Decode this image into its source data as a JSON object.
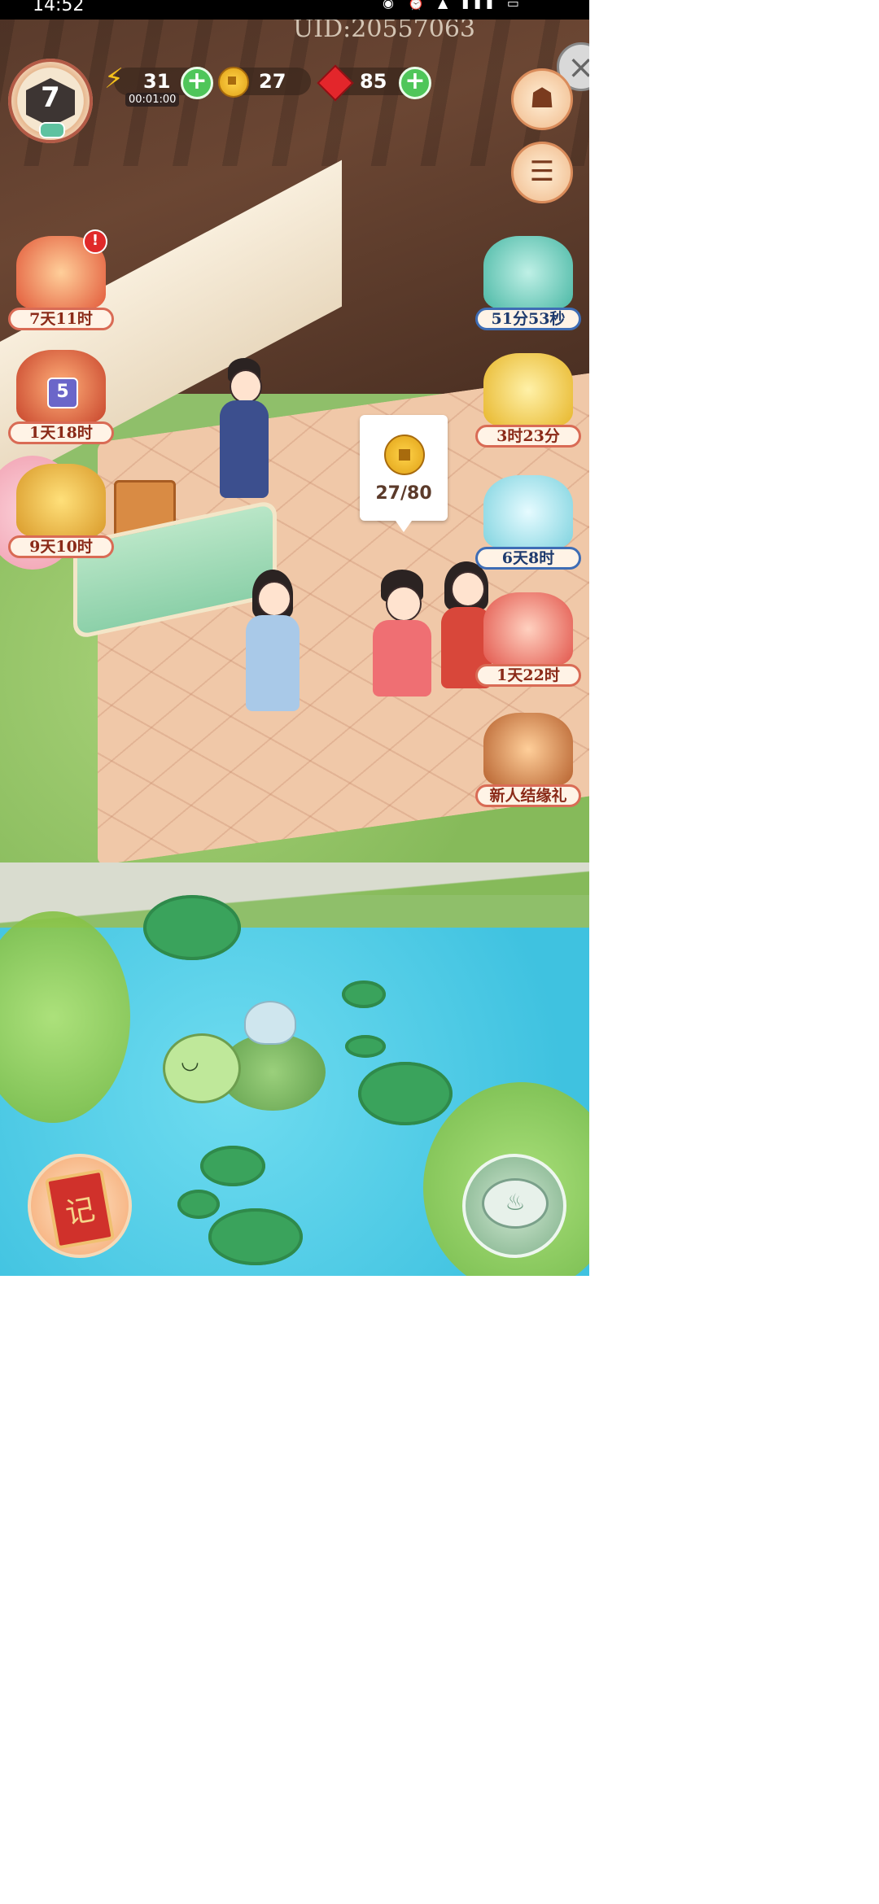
{
  "status_bar": {
    "time": "14:52",
    "icons": "◉ ⏰ ▲ ▮▮▮ ▭"
  },
  "header": {
    "uid": "UID:20557063"
  },
  "player": {
    "level": "7"
  },
  "resources": {
    "energy": {
      "value": "31",
      "timer": "00:01:00",
      "icon": "lightning-icon"
    },
    "coins": {
      "value": "27",
      "icon": "coin-icon"
    },
    "gems": {
      "value": "85",
      "icon": "ruby-icon"
    },
    "plus": "+"
  },
  "left_events": [
    {
      "name": "event-mail-gift",
      "label": "7天11时",
      "alert": "!"
    },
    {
      "name": "event-lantern-box",
      "label": "1天18时",
      "badge": "5"
    },
    {
      "name": "event-wheat-harvest",
      "label": "9天10时"
    }
  ],
  "right_events": [
    {
      "name": "event-cat-cart",
      "label": "51分53秒"
    },
    {
      "name": "event-golden-chest",
      "label": "3时23分"
    },
    {
      "name": "event-ice-gift",
      "label": "6天8时"
    },
    {
      "name": "event-lovers-gift",
      "label": "1天22时"
    },
    {
      "name": "event-newbie-matchmaking",
      "label": "新人结缘礼"
    }
  ],
  "coin_bubble": {
    "progress_text": "27/80",
    "progress_fraction": 0.3375
  },
  "buttons": {
    "close": "×",
    "shop_icon": "☗",
    "menu_icon": "☰",
    "book_glyph": "记",
    "teapot_glyph": "♨"
  },
  "colors": {
    "label_border_red": "#d96b55",
    "label_border_blue": "#3e6db5",
    "plus_green": "#4fc65a",
    "pond_blue": "#3fc2e0"
  }
}
